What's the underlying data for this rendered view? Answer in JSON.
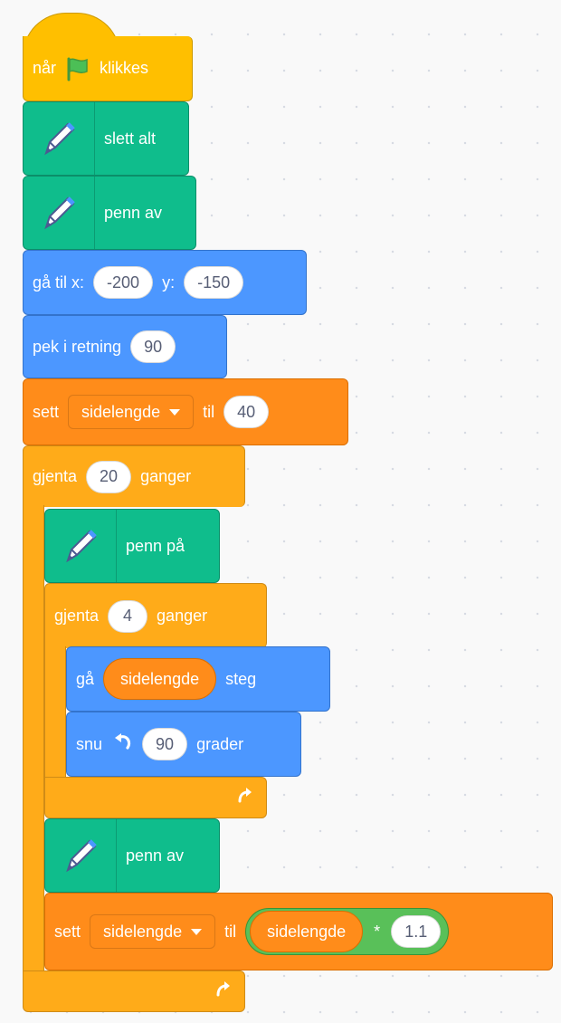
{
  "script": {
    "hat": {
      "when": "når",
      "clicked": "klikkes",
      "icon": "green-flag-icon"
    },
    "erase": {
      "label": "slett alt",
      "icon": "pen-icon"
    },
    "pen_up_1": {
      "label": "penn av",
      "icon": "pen-icon"
    },
    "goto": {
      "label": "gå til x:",
      "x": "-200",
      "y_label": "y:",
      "y": "-150"
    },
    "point": {
      "label": "pek i retning",
      "value": "90"
    },
    "set1": {
      "label": "sett",
      "variable": "sidelengde",
      "to": "til",
      "value": "40"
    },
    "repeat_outer": {
      "label": "gjenta",
      "times": "20",
      "suffix": "ganger"
    },
    "pen_down": {
      "label": "penn på",
      "icon": "pen-icon"
    },
    "repeat_inner": {
      "label": "gjenta",
      "times": "4",
      "suffix": "ganger"
    },
    "move": {
      "label": "gå",
      "reporter": "sidelengde",
      "suffix": "steg"
    },
    "turn": {
      "label": "snu",
      "icon": "rotate-left-icon",
      "value": "90",
      "suffix": "grader"
    },
    "pen_up_2": {
      "label": "penn av",
      "icon": "pen-icon"
    },
    "set2": {
      "label": "sett",
      "variable": "sidelengde",
      "to": "til",
      "reporter": "sidelengde",
      "operator": "*",
      "value": "1.1"
    }
  },
  "colors": {
    "events": "#FFBF00",
    "pen": "#0FBD8C",
    "motion": "#4C97FF",
    "variables": "#FF8C1A",
    "control": "#FFAB19",
    "operators": "#59C059"
  }
}
